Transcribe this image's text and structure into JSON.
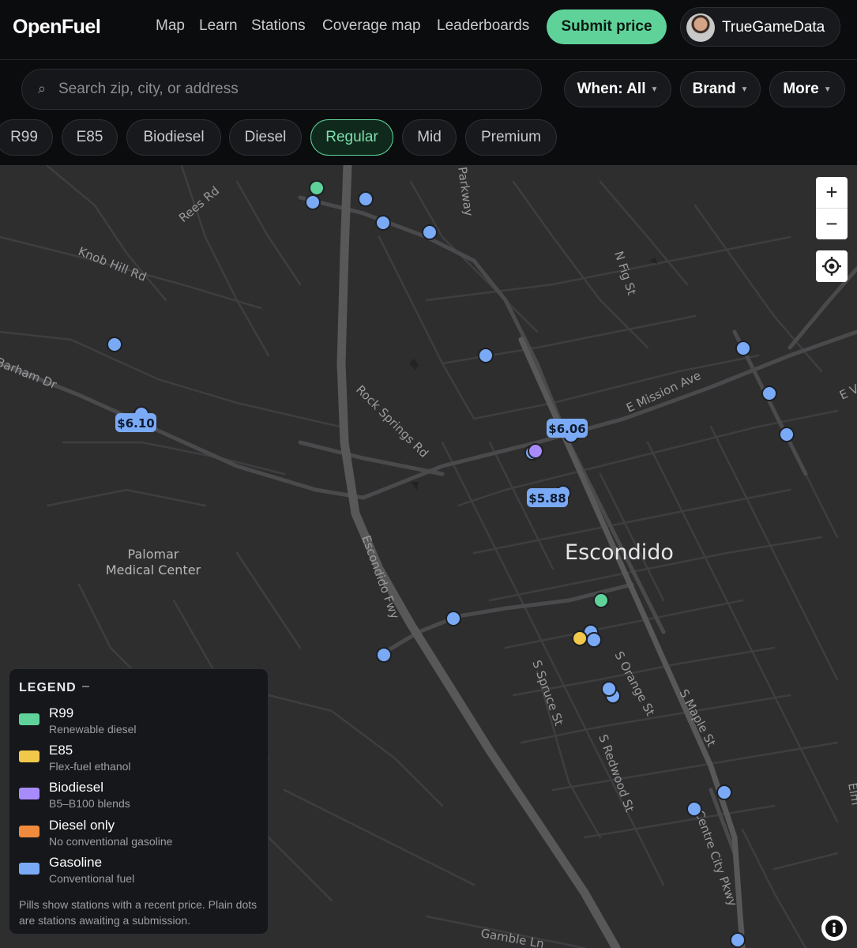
{
  "header": {
    "logo": "OpenFuel",
    "nav": [
      "Map",
      "Learn",
      "Stations",
      "Coverage map",
      "Leaderboards"
    ],
    "submit_label": "Submit price",
    "username": "TrueGameData"
  },
  "filters": {
    "search_placeholder": "Search zip, city, or address",
    "when_label": "When: All",
    "brand_label": "Brand",
    "more_label": "More",
    "fuel_types": [
      "R99",
      "E85",
      "Biodiesel",
      "Diesel",
      "Regular",
      "Mid",
      "Premium"
    ],
    "active_fuel": "Regular"
  },
  "map": {
    "city_label": "Escondido",
    "poi_label_line1": "Palomar",
    "poi_label_line2": "Medical Center",
    "street_labels": [
      "Rees Rd",
      "Knob Hill Rd",
      "Parkway",
      "N Fig St",
      "Barham Dr",
      "Rock Springs Rd",
      "E Mission Ave",
      "E V",
      "Escondido Fwy",
      "S Spruce St",
      "S Orange St",
      "S Maple St",
      "S Redwood St",
      "Centre City Pkwy",
      "Gamble Ln",
      "Elm"
    ],
    "price_pills": [
      "$6.10",
      "$6.06",
      "$5.88"
    ],
    "zoom_in": "+",
    "zoom_out": "−"
  },
  "legend": {
    "title": "LEGEND",
    "collapse": "–",
    "items": [
      {
        "label": "R99",
        "sub": "Renewable diesel",
        "color": "#5fd29a"
      },
      {
        "label": "E85",
        "sub": "Flex-fuel ethanol",
        "color": "#f2c84b"
      },
      {
        "label": "Biodiesel",
        "sub": "B5–B100 blends",
        "color": "#a78bfa"
      },
      {
        "label": "Diesel only",
        "sub": "No conventional gasoline",
        "color": "#f08a3c"
      },
      {
        "label": "Gasoline",
        "sub": "Conventional fuel",
        "color": "#7aaaf5"
      }
    ],
    "note": "Pills show stations with a recent price. Plain dots are stations awaiting a submission."
  }
}
